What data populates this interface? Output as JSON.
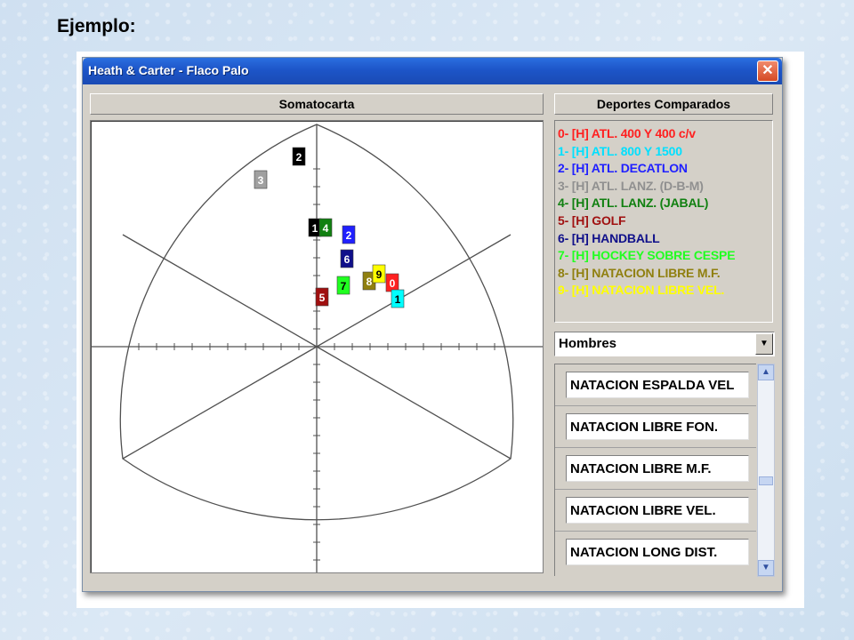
{
  "page": {
    "heading": "Ejemplo:"
  },
  "window": {
    "title": "Heath & Carter - Flaco Palo",
    "close_label": "✕"
  },
  "somatochart": {
    "header": "Somatocarta",
    "markers": [
      {
        "label": "0",
        "color": "#ff2020",
        "text_color": "#ffffff"
      },
      {
        "label": "1",
        "color": "#00ffff",
        "text_color": "#000000"
      },
      {
        "label": "1",
        "color": "#000000",
        "text_color": "#ffffff"
      },
      {
        "label": "2",
        "color": "#000000",
        "text_color": "#ffffff"
      },
      {
        "label": "2",
        "color": "#2020ff",
        "text_color": "#ffffff"
      },
      {
        "label": "3",
        "color": "#a0a0a0",
        "text_color": "#ffffff"
      },
      {
        "label": "4",
        "color": "#108010",
        "text_color": "#ffffff"
      },
      {
        "label": "5",
        "color": "#a01010",
        "text_color": "#ffffff"
      },
      {
        "label": "6",
        "color": "#10108a",
        "text_color": "#ffffff"
      },
      {
        "label": "7",
        "color": "#20ff20",
        "text_color": "#000000"
      },
      {
        "label": "8",
        "color": "#908010",
        "text_color": "#ffffff"
      },
      {
        "label": "9",
        "color": "#ffff00",
        "text_color": "#000000"
      }
    ]
  },
  "compared_sports": {
    "header": "Deportes Comparados",
    "items": [
      {
        "label": "0- [H] ATL. 400 Y 400 c/v",
        "color": "#ff2020"
      },
      {
        "label": "1- [H] ATL. 800 Y 1500",
        "color": "#00e0ff"
      },
      {
        "label": "2- [H] ATL. DECATLON",
        "color": "#2020ff"
      },
      {
        "label": "3- [H] ATL. LANZ. (D-B-M)",
        "color": "#909090"
      },
      {
        "label": "4- [H] ATL. LANZ. (JABAL)",
        "color": "#108010"
      },
      {
        "label": "5- [H] GOLF",
        "color": "#a01010"
      },
      {
        "label": "6- [H] HANDBALL",
        "color": "#10108a"
      },
      {
        "label": "7- [H] HOCKEY SOBRE CESPE",
        "color": "#20ff20"
      },
      {
        "label": "8- [H] NATACION LIBRE M.F.",
        "color": "#908010"
      },
      {
        "label": "9- [H] NATACION LIBRE VEL.",
        "color": "#ffff00"
      }
    ]
  },
  "gender_select": {
    "value": "Hombres",
    "arrow": "▼"
  },
  "sport_options": [
    "NATACION ESPALDA VEL",
    "NATACION LIBRE FON.",
    "NATACION LIBRE M.F.",
    "NATACION LIBRE VEL.",
    "NATACION LONG DIST."
  ],
  "scroll": {
    "up": "▲",
    "down": "▼"
  }
}
